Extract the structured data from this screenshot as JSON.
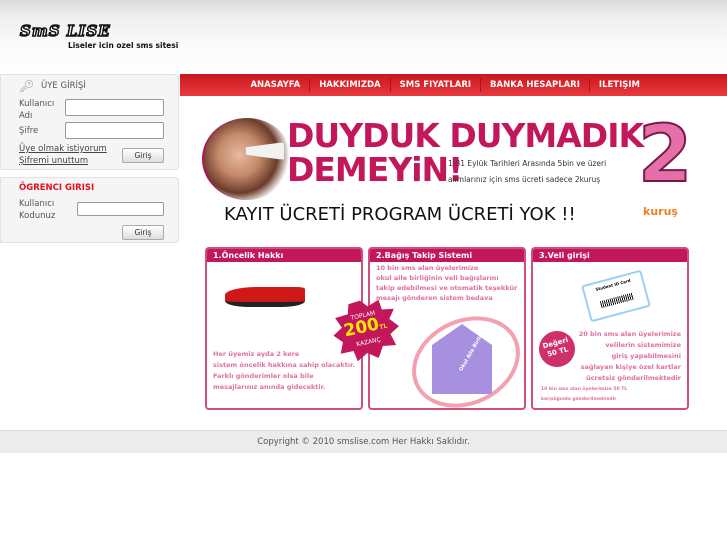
{
  "header": {
    "logo": "SmS LISE",
    "tagline": "Liseler icin ozel sms sitesi"
  },
  "nav": [
    "ANASAYFA",
    "HAKKIMIZDA",
    "SMS FIYATLARI",
    "BANKA HESAPLARI",
    "ILETIŞIM"
  ],
  "member_login": {
    "title": "ÜYE GİRİŞİ",
    "username_label": "Kullanıcı Adı",
    "password_label": "Şifre",
    "register_link": "Üye olmak istiyorum",
    "forgot_link": "Şifremi unuttum",
    "button": "Giriş"
  },
  "student_login": {
    "title": "ÖGRENCI GIRISI",
    "code_label": "Kullanıcı Kodunuz",
    "button": "Giriş"
  },
  "banner": {
    "headline1": "DUYDUK DUYMADIK",
    "headline2": "DEMEYiN!",
    "sub1": "1-31 Eylük Tarihleri Arasında 5bin ve üzeri",
    "sub2": "alımlarınız için sms ücreti sadece 2kuruş",
    "big_number": "2",
    "big_unit": "kuruş",
    "tagline": "KAYIT ÜCRETİ PROGRAM ÜCRETİ YOK !!"
  },
  "cards": [
    {
      "title": "1.Öncelik Hakkı",
      "text": [
        "Her üyemiz ayda 2 kere",
        "sistem öncelik hakkına sahip olacaktır.",
        "Farklı gönderimler olsa bile",
        "mesajlarınız anında gidecektir."
      ],
      "badge_top": "TOPLAM",
      "badge_value": "200",
      "badge_unit": "TL",
      "badge_bottom": "KAZANÇ"
    },
    {
      "title": "2.Bağış Takip Sistemi",
      "text": [
        "10 bin sms alan üyelerimize",
        "okul aile birliğinin veli bağışlarını",
        "takip edebilmesi ve otomatik teşekkür",
        "mesajı gönderen sistem bedava"
      ],
      "house_label": "Okul Aile Birliği"
    },
    {
      "title": "3.Veli girişi",
      "card_label": "Student ID Card",
      "badge": "Değeri 50 TL",
      "text": [
        "20 bin sms alan üyelerimize",
        "velilerin sistemimize",
        "giriş yapabilmesini",
        "sağlayan kişiye özel kartlar",
        "ücretsiz gönderilmektedir"
      ],
      "note": [
        "10 bin sms alan üyelerimize 50 TL",
        "karşılığında gönderilmektedir"
      ]
    }
  ],
  "footer": "Copyright © 2010 smslise.com Her Hakkı Saklıdır."
}
